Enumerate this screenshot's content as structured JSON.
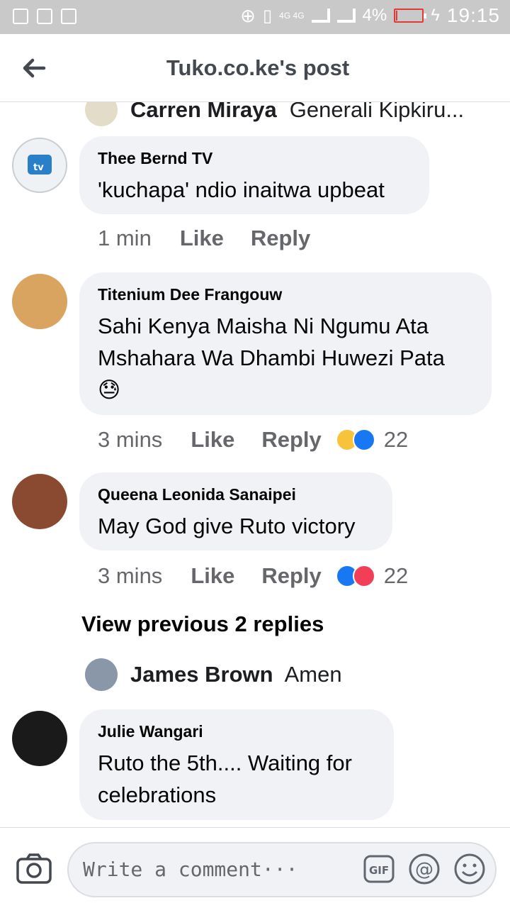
{
  "status_bar": {
    "network": "4G 4G",
    "battery_percent": "4%",
    "battery_level": 0.04,
    "time": "19:15"
  },
  "header": {
    "title": "Tuko.co.ke's post"
  },
  "reply_peek": {
    "name": "Carren Miraya",
    "text": "Generali Kipkiru..."
  },
  "comments": [
    {
      "name": "Thee Bernd TV",
      "text": "'kuchapa' ndio inaitwa upbeat",
      "time": "1 min",
      "like": "Like",
      "reply": "Reply",
      "reactions": null
    },
    {
      "name": "Titenium Dee Frangouw",
      "text": "Sahi Kenya Maisha Ni Ngumu Ata Mshahara Wa Dhambi Huwezi Pata",
      "emoji": "😓",
      "time": "3 mins",
      "like": "Like",
      "reply": "Reply",
      "reactions": {
        "icons": [
          "haha",
          "like"
        ],
        "count": "22"
      }
    },
    {
      "name": "Queena Leonida Sanaipei",
      "text": "May God give Ruto victory",
      "time": "3 mins",
      "like": "Like",
      "reply": "Reply",
      "reactions": {
        "icons": [
          "like",
          "love"
        ],
        "count": "22"
      }
    },
    {
      "name": "Julie Wangari",
      "text": "Ruto the 5th.... Waiting for celebrations"
    }
  ],
  "view_previous": "View previous 2 replies",
  "nested_reply": {
    "name": "James Brown",
    "text": "Amen"
  },
  "composer": {
    "placeholder": "Write a comment···",
    "gif_label": "GIF"
  },
  "colors": {
    "status_bar_bg": "#c9c9c9",
    "bubble_bg": "#f0f2f5",
    "like_blue": "#1877f2",
    "love_red": "#f33e58",
    "haha_yellow": "#f7c33b",
    "battery_red": "#e53935"
  }
}
